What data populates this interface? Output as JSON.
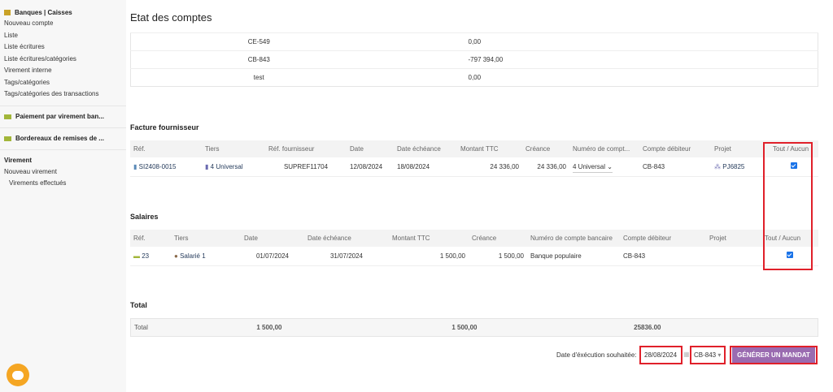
{
  "sidebar": {
    "section1": "Banques | Caisses",
    "items1": [
      "Nouveau compte",
      "Liste",
      "Liste écritures",
      "Liste écritures/catégories",
      "Virement interne",
      "Tags/catégories",
      "Tags/catégories des transactions"
    ],
    "section2": "Paiement par virement ban...",
    "section3": "Bordereaux de remises de ...",
    "section4": "Virement",
    "items4": [
      "Nouveau virement",
      "Virements effectués"
    ]
  },
  "page_title": "Etat des comptes",
  "etat": [
    {
      "account": "CE-549",
      "balance": "0,00"
    },
    {
      "account": "CB-843",
      "balance": "-797 394,00"
    },
    {
      "account": "test",
      "balance": "0,00"
    }
  ],
  "facture": {
    "title": "Facture fournisseur",
    "headers": [
      "Réf.",
      "Tiers",
      "Réf. fournisseur",
      "Date",
      "Date échéance",
      "Montant TTC",
      "Créance",
      "Numéro de compt...",
      "Compte débiteur",
      "Projet",
      "Tout / Aucun"
    ],
    "row": {
      "ref": "SI2408-0015",
      "tiers": "4 Universal",
      "ref_fourn": "SUPREF11704",
      "date": "12/08/2024",
      "echeance": "18/08/2024",
      "montant": "24 336,00",
      "creance": "24 336,00",
      "compte": "4 Universal",
      "debiteur": "CB-843",
      "projet": "PJ6825",
      "checked": true
    }
  },
  "salaires": {
    "title": "Salaires",
    "headers": [
      "Réf.",
      "Tiers",
      "Date",
      "Date échéance",
      "Montant TTC",
      "Créance",
      "Numéro de compte bancaire",
      "Compte débiteur",
      "Projet",
      "Tout / Aucun"
    ],
    "row": {
      "ref": "23",
      "tiers": "Salarié 1",
      "date": "01/07/2024",
      "echeance": "31/07/2024",
      "montant": "1 500,00",
      "creance": "1 500,00",
      "compte": "Banque populaire",
      "debiteur": "CB-843",
      "projet": "",
      "checked": true
    }
  },
  "total": {
    "title": "Total",
    "label": "Total",
    "v1": "1 500,00",
    "v2": "1 500,00",
    "v3": "25836.00"
  },
  "footer": {
    "date_label": "Date d'éxécution souhaitée:",
    "date_value": "28/08/2024",
    "account": "CB-843",
    "button": "GÉNÉRER UN MANDAT"
  }
}
